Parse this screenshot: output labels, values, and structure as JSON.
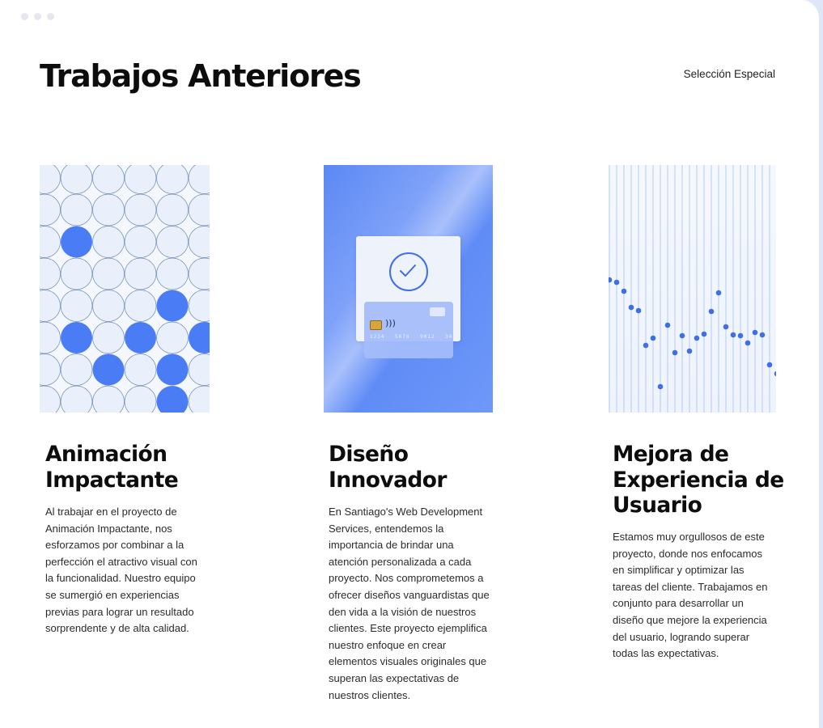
{
  "page": {
    "title": "Trabajos Anteriores",
    "header_link": "Selección Especial"
  },
  "colors": {
    "accent": "#4a7cf6",
    "background": "#ffffff",
    "text": "#0d0d0d"
  },
  "projects": [
    {
      "title": "Animación Impactante",
      "image_icon": "circle-grid-illustration",
      "description": "Al trabajar en el proyecto de Animación Impactante, nos esforzamos por combinar a la perfección el atractivo visual con la funcionalidad. Nuestro equipo se sumergió en experiencias previas para lograr un resultado sorprendente y de alta calidad."
    },
    {
      "title": "Diseño Innovador",
      "image_icon": "payment-card-illustration",
      "card_number": "1234 5678 9012 3456",
      "description": "En Santiago's Web Development Services, entendemos la importancia de brindar una atención personalizada a cada proyecto. Nos comprometemos a ofrecer diseños vanguardistas que den vida a la visión de nuestros clientes. Este proyecto ejemplifica nuestro enfoque en crear elementos visuales originales que superan las expectativas de nuestros clientes."
    },
    {
      "title": "Mejora de Experiencia de Usuario",
      "image_icon": "dot-line-illustration",
      "description": "Estamos muy orgullosos de este proyecto, donde nos enfocamos en simplificar y optimizar las tareas del cliente. Trabajamos en conjunto para desarrollar un diseño que mejore la experiencia del usuario, logrando superar todas las expectativas."
    }
  ]
}
